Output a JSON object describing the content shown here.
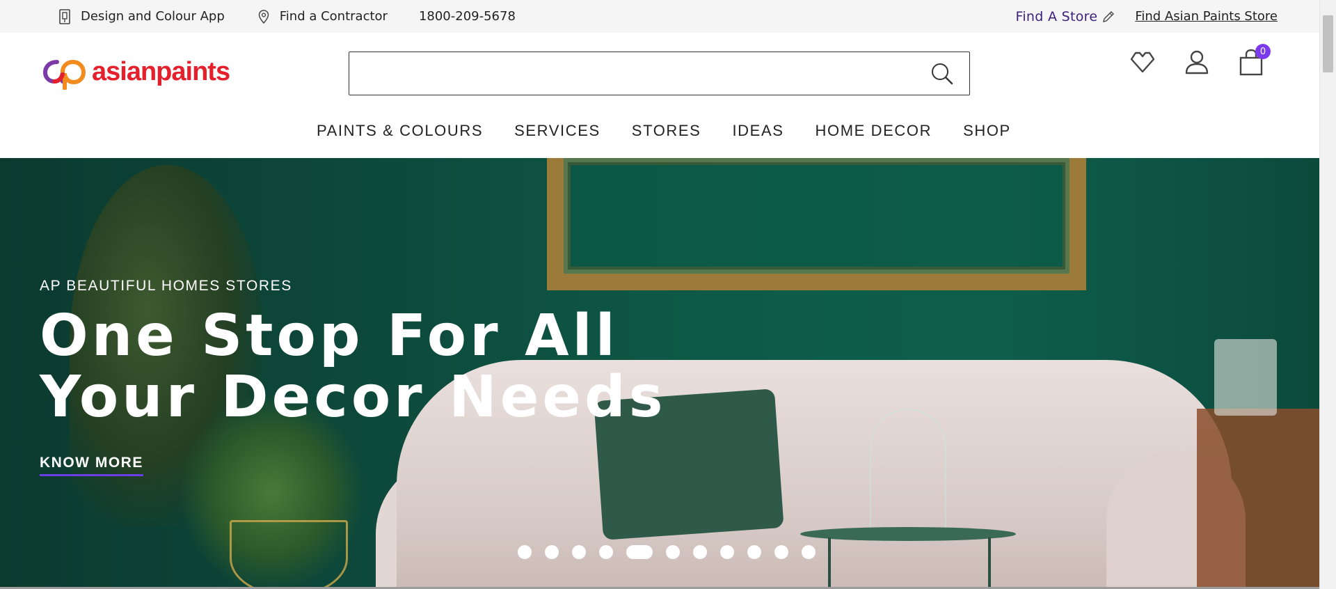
{
  "utility_bar": {
    "design_app": "Design and Colour App",
    "find_contractor": "Find a Contractor",
    "phone": "1800-209-5678",
    "find_store": "Find A Store",
    "find_ap_store": "Find Asian Paints Store"
  },
  "header": {
    "logo_text": "asianpaints",
    "search_placeholder": "",
    "cart_count": "0"
  },
  "nav": {
    "items": [
      "PAINTS & COLOURS",
      "SERVICES",
      "STORES",
      "IDEAS",
      "HOME DECOR",
      "SHOP"
    ]
  },
  "hero": {
    "eyebrow": "AP BEAUTIFUL HOMES STORES",
    "headline_line1": "One Stop For All",
    "headline_line2": "Your Decor Needs",
    "cta": "KNOW MORE",
    "slide_count": 11,
    "active_slide": 5
  },
  "colors": {
    "brand_red": "#e4202c",
    "brand_purple": "#7c3aed",
    "find_store_text": "#3c1f7a",
    "hero_green": "#0e5a48"
  },
  "icons": [
    "app-icon",
    "location-pin-icon",
    "pencil-icon",
    "search-icon",
    "heart-icon",
    "user-icon",
    "cart-icon"
  ]
}
